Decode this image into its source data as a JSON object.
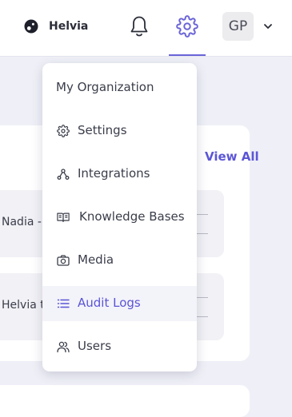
{
  "brand": {
    "name": "Helvia"
  },
  "header": {
    "avatar_initials": "GP",
    "icons": [
      "bell-icon",
      "gear-icon",
      "chevron-down-icon"
    ],
    "accent": "#6a64d8"
  },
  "menu": {
    "header": "My Organization",
    "items": [
      {
        "label": "Settings",
        "icon": "gear-icon",
        "active": false
      },
      {
        "label": "Integrations",
        "icon": "integrations-icon",
        "active": false
      },
      {
        "label": "Knowledge Bases",
        "icon": "book-icon",
        "active": false
      },
      {
        "label": "Media",
        "icon": "camera-icon",
        "active": false
      },
      {
        "label": "Audit Logs",
        "icon": "list-icon",
        "active": true
      },
      {
        "label": "Users",
        "icon": "users-icon",
        "active": false
      }
    ]
  },
  "background": {
    "view_all": "View All",
    "rows": [
      {
        "text": "Nadia -"
      },
      {
        "text": "Helvia t"
      }
    ]
  }
}
